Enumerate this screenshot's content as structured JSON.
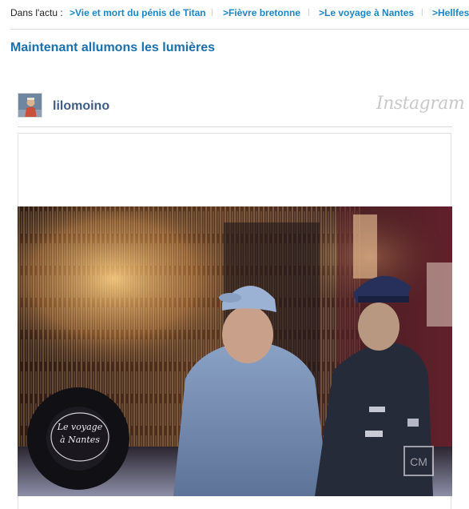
{
  "actu": {
    "label": "Dans l'actu :",
    "links": [
      ">Vie et mort du pénis de Titan",
      ">Fièvre bretonne",
      ">Le voyage à Nantes",
      ">Hellfes"
    ],
    "separator": "|"
  },
  "article": {
    "title": "Maintenant allumons les lumières"
  },
  "instagram": {
    "username": "lilomoino",
    "logo_text": "Instagram"
  },
  "photo": {
    "tire_text": "Le voyage à Nantes",
    "watermark_text": "CM"
  },
  "colors": {
    "link": "#1b87c6",
    "title": "#1a6fad",
    "username": "#3f5e84"
  }
}
